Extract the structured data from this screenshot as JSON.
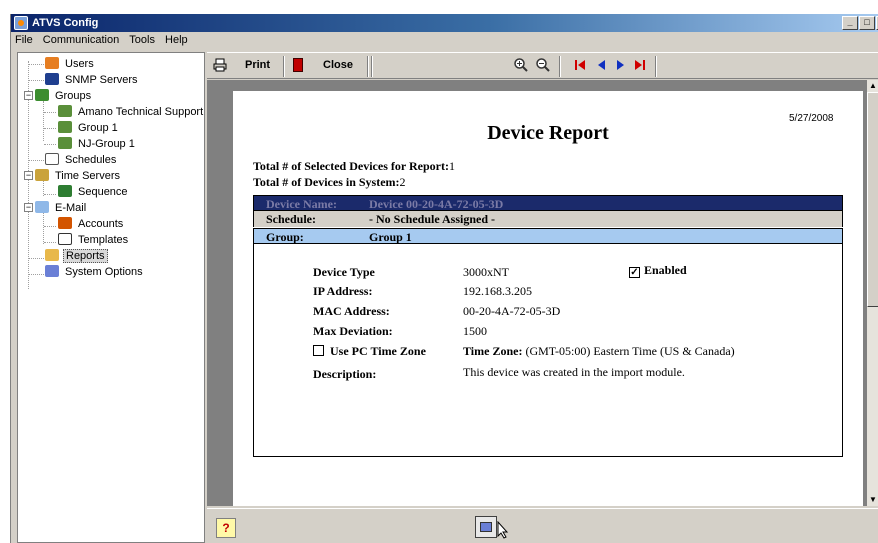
{
  "window": {
    "title": "ATVS Config",
    "controls": [
      "_",
      "□",
      "X"
    ]
  },
  "menu": [
    "File",
    "Communication",
    "Tools",
    "Help"
  ],
  "sidebar": {
    "items": [
      {
        "label": "Users",
        "icon": "users-icon"
      },
      {
        "label": "SNMP Servers",
        "icon": "snmp-server-icon"
      },
      {
        "label": "Groups",
        "icon": "groups-icon"
      },
      {
        "label": "Amano Technical Support",
        "icon": "group-icon"
      },
      {
        "label": "Group 1",
        "icon": "group-icon"
      },
      {
        "label": "NJ-Group 1",
        "icon": "group-icon"
      },
      {
        "label": "Schedules",
        "icon": "calendar-icon"
      },
      {
        "label": "Time Servers",
        "icon": "time-server-icon"
      },
      {
        "label": "Sequence",
        "icon": "sequence-icon"
      },
      {
        "label": "E-Mail",
        "icon": "folder-icon"
      },
      {
        "label": "Accounts",
        "icon": "accounts-icon"
      },
      {
        "label": "Templates",
        "icon": "templates-icon"
      },
      {
        "label": "Reports",
        "icon": "reports-icon"
      },
      {
        "label": "System Options",
        "icon": "system-options-icon"
      }
    ],
    "selected": "Reports"
  },
  "toolbar": {
    "print_label": "Print",
    "close_label": "Close"
  },
  "report": {
    "date": "5/27/2008",
    "title": "Device Report",
    "selected_devices_label": "Total # of Selected Devices for Report:",
    "selected_devices_value": "1",
    "total_devices_label": "Total # of Devices in System:",
    "total_devices_value": "2",
    "device_name_label": "Device Name:",
    "device_name_value": "Device 00-20-4A-72-05-3D",
    "schedule_label": "Schedule:",
    "schedule_value": "- No Schedule Assigned -",
    "group_label": "Group:",
    "group_value": "Group 1",
    "device_type_label": "Device Type",
    "device_type_value": "3000xNT",
    "enabled_label": "Enabled",
    "enabled_checked": true,
    "ip_label": "IP Address:",
    "ip_value": "192.168.3.205",
    "mac_label": "MAC Address:",
    "mac_value": "00-20-4A-72-05-3D",
    "max_dev_label": "Max Deviation:",
    "max_dev_value": "1500",
    "use_pc_tz_label": "Use PC Time Zone",
    "use_pc_tz_checked": false,
    "time_zone_label": "Time Zone:",
    "time_zone_value": "(GMT-05:00) Eastern Time (US & Canada)",
    "description_label": "Description:",
    "description_value": "This device was created in the import module."
  },
  "status": {
    "help_glyph": "?"
  },
  "colors": {
    "title_start": "#0a246a",
    "device_band": "#1b2a6b",
    "device_band_text": "#7b7ba6",
    "schedule_band": "#d4d0c8",
    "group_band": "#a6caf0"
  }
}
